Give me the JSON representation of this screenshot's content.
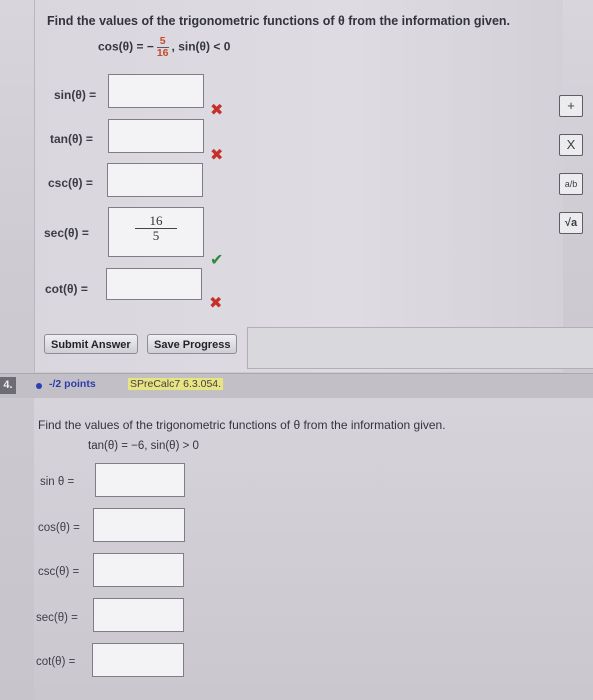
{
  "problem1": {
    "prompt": "Find the values of the trigonometric functions of θ from the information given.",
    "given_lhs": "cos(θ) = −",
    "given_num": "5",
    "given_den": "16",
    "given_rhs": ",   sin(θ) < 0",
    "rows": [
      {
        "label": "sin(θ) =",
        "status": "incorrect"
      },
      {
        "label": "tan(θ) =",
        "status": "incorrect"
      },
      {
        "label": "csc(θ) =",
        "status": ""
      },
      {
        "label": "sec(θ) =",
        "status": "correct",
        "num": "16",
        "den": "5"
      },
      {
        "label": "cot(θ) =",
        "status": "incorrect"
      }
    ],
    "submit_label": "Submit Answer",
    "save_label": "Save Progress"
  },
  "tools": [
    "+",
    "X",
    "a/b",
    "√a"
  ],
  "problem2_header": {
    "number": "4.",
    "points": "-/2 points",
    "assignment": "SPreCalc7 6.3.054."
  },
  "problem2": {
    "prompt": "Find the values of the trigonometric functions of θ from the information given.",
    "given": "tan(θ) = −6,   sin(θ) > 0",
    "rows": [
      {
        "label": "sin θ    ="
      },
      {
        "label": "cos(θ) ="
      },
      {
        "label": "csc(θ) ="
      },
      {
        "label": "sec(θ) ="
      },
      {
        "label": "cot(θ) ="
      }
    ]
  },
  "colors": {
    "incorrect": "#c5302a",
    "correct": "#2d8a3a",
    "points": "#2d3da8"
  }
}
